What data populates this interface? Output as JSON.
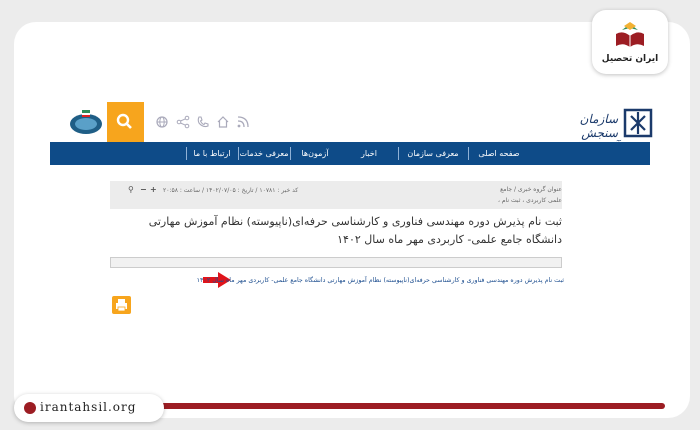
{
  "watermark": {
    "brand": "ایران تحصیل",
    "site": "irantahsil.org"
  },
  "header": {
    "org_name": "سازمان سنجش آموزش کشور"
  },
  "nav": {
    "items": [
      "صفحه اصلی",
      "معرفی سازمان",
      "اخبار",
      "آزمون‌ها",
      "معرفی خدمات",
      "ارتباط با ما"
    ]
  },
  "crumbs": {
    "group": "عنوان گروه خبری / جامع",
    "subgroup": "علمی کاربردی ، ثبت نام ،",
    "meta": "کد خبر : ۱۰۷۸۱   /   تاریخ : ۱۴۰۲/۰۷/۰۵   /   ساعت : ۲۰:۵۸"
  },
  "article": {
    "title": "ثبت نام پذیرش دوره مهندسی فناوری و کارشناسی حرفه‌ای(ناپیوسته) نظام آموزش مهارتی دانشگاه جامع علمی- کاربردی مهر ماه سال ۱۴۰۲",
    "link_text": "ثبت نام پذیرش دوره مهندسی فناوری و کارشناسی حرفه‌ای(ناپیوسته) نظام آموزش مهارتی دانشگاه جامع علمی- کاربردی مهر ماه سال ۱۴۰۲"
  },
  "colors": {
    "nav_blue": "#0e4b88",
    "accent_orange": "#f7a51d",
    "brand_red": "#9c1d23",
    "arrow_red": "#e0141b"
  },
  "icons": [
    "search-icon",
    "globe-icon",
    "share-icon",
    "phone-icon",
    "home-icon",
    "rss-icon",
    "print-icon",
    "zoom-icon"
  ]
}
